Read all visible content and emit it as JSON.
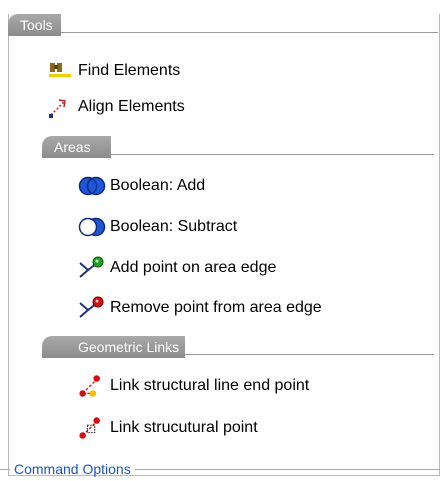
{
  "tools": {
    "title": "Tools",
    "items": [
      {
        "label": "Find Elements",
        "icon": "binoculars-icon"
      },
      {
        "label": "Align Elements",
        "icon": "align-arrow-icon"
      }
    ]
  },
  "areas": {
    "title": "Areas",
    "items": [
      {
        "label": "Boolean: Add",
        "icon": "boolean-add-icon"
      },
      {
        "label": "Boolean: Subtract",
        "icon": "boolean-subtract-icon"
      },
      {
        "label": "Add point on area edge",
        "icon": "add-point-icon"
      },
      {
        "label": "Remove point from area edge",
        "icon": "remove-point-icon"
      }
    ]
  },
  "geometric_links": {
    "title": "Geometric Links",
    "items": [
      {
        "label": "Link structural line end point",
        "icon": "link-line-end-icon"
      },
      {
        "label": "Link strucutural point",
        "icon": "link-point-icon"
      }
    ]
  },
  "command_options": {
    "label": "Command Options"
  },
  "colors": {
    "header_tab": "#9a9a9a",
    "link_blue": "#1a56c0",
    "boolean_blue": "#1e56d6",
    "point_red": "#d01010"
  }
}
